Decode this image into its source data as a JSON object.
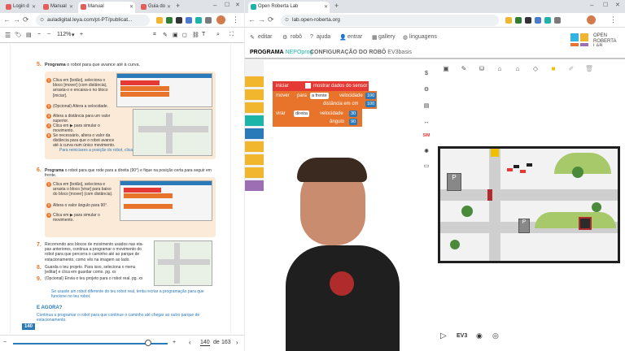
{
  "left_browser": {
    "tabs": [
      {
        "label": "Login d",
        "color": "#e35d5b"
      },
      {
        "label": "Manual",
        "color": "#e35d5b"
      },
      {
        "label": "Manual",
        "color": "#e35d5b"
      },
      {
        "label": "Guia do",
        "color": "#e35d5b"
      }
    ],
    "url": "auladigital.leya.com/pt-PT/publicat...",
    "zoom": "112%",
    "page_label": "140",
    "page_current": "140",
    "page_sep": "de",
    "page_total": "163",
    "plus": "+",
    "minus": "−"
  },
  "pdf": {
    "step5": {
      "num": "5.",
      "title_bold": "Programa",
      "title_rest": "o robot para que avance até à curva."
    },
    "step5_items": [
      "Clica em [botão], seleciona o bloco [mover] (com distância), arrasta-o e encaixa-o no bloco [iniciar].",
      "(Opcional) Altera a velocidade.",
      "Altera a distância para um valor superior.",
      "Clica em ▶ para simular o movimento.",
      "Se necessário, altera o valor da distância para que o robot avance até à curva num único movimento."
    ],
    "step5_tip": "Para reiniciares a posição do robot, clica em ⟲.",
    "step6": {
      "num": "6.",
      "title_bold": "Programa",
      "title_rest": "o robot para que rode para a direita (90°) e fique na posição certa para seguir em frente."
    },
    "step6_items": [
      "Clica em [botão], seleciona e arrasta o bloco [virar] para baixo do bloco [mover] (com distância).",
      "Altera o valor ângulo para 90°.",
      "Clica em ▶ para simular o movimento."
    ],
    "step7": {
      "num": "7.",
      "text": "Recorrendo aos blocos de movimento usados nas eta- pas anteriores, continua a programar o movimento do robot para que percorra o caminho até ao parque de estacionamento, como vês na imagem ao lado."
    },
    "step8": {
      "num": "8.",
      "text": "Guarda o teu projeto. Para isso, seleciona o menu [editar] e clica em guardar como. pg. xx"
    },
    "step9": {
      "num": "9.",
      "text": "(Opcional) Envia o teu projeto para o robot real. pg. xx"
    },
    "note": "Se usaste um robot diferente do teu robot real, tenta recriar a programação para que funcione no teu robot.",
    "e_agora_title": "E AGORA?",
    "e_agora_text": "Continua a programar o robot para que continue o caminho até chegar ao outro parque de estacionamento."
  },
  "right_browser": {
    "tab_title": "Open Roberta Lab",
    "url": "lab.open-roberta.org",
    "menu": [
      "editar",
      "robô",
      "ajuda",
      "entrar",
      "gallery",
      "linguagens"
    ],
    "brand": [
      "OPEN",
      "ROBERTA",
      "LAB"
    ],
    "program_tab_bold": "PROGRAMA",
    "program_tab_name": "NEPOprog",
    "config_tab_bold": "CONFIGURAÇÃO DO ROBÔ",
    "config_tab_name": "EV3basis",
    "sim_label": "SIM",
    "ev3_label": "EV3"
  },
  "blocks": {
    "start": {
      "label": "iniciar",
      "checkbox_label": "mostrar dados do sensor"
    },
    "move": {
      "label": "mover",
      "para": "para",
      "direction": "a frente",
      "speed_label": "velocidade",
      "speed": "100",
      "distance_label": "distância em cm",
      "distance": "100"
    },
    "turn": {
      "label": "virar",
      "direction": "direita",
      "speed_label": "velocidade",
      "speed": "30",
      "angle_label": "ângulo",
      "angle": "90"
    }
  },
  "colors": {
    "block_orange": "#e8742c",
    "block_red": "#e53935",
    "nepo_teal": "#1cb3a8",
    "cat_yellow": "#f1b62e",
    "cat_blue": "#2a79b8",
    "sim_border": "#1f1f1f",
    "sim_stripe": "#f0c000"
  }
}
